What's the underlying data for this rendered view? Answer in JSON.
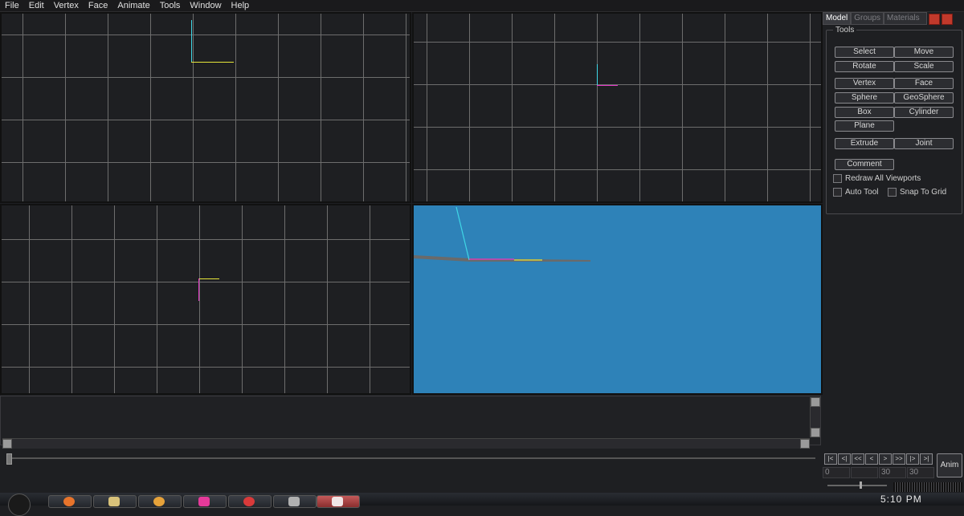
{
  "menubar": {
    "items": [
      "File",
      "Edit",
      "Vertex",
      "Face",
      "Animate",
      "Tools",
      "Window",
      "Help"
    ]
  },
  "right_panel": {
    "tabs": [
      "Model",
      "Groups",
      "Materials"
    ],
    "tools_title": "Tools",
    "buttons": {
      "select": "Select",
      "move": "Move",
      "rotate": "Rotate",
      "scale": "Scale",
      "vertex": "Vertex",
      "face": "Face",
      "sphere": "Sphere",
      "geosphere": "GeoSphere",
      "box": "Box",
      "cylinder": "Cylinder",
      "plane": "Plane",
      "extrude": "Extrude",
      "joint": "Joint",
      "comment": "Comment"
    },
    "checkboxes": {
      "redraw_all": "Redraw All Viewports",
      "auto_tool": "Auto Tool",
      "snap_to_grid": "Snap To Grid"
    }
  },
  "anim_controls": {
    "anim_label": "Anim",
    "frame_start": "0",
    "frame_end": "30",
    "frame_total": "30",
    "nav_buttons": [
      "|<",
      "<|",
      "<<",
      "<",
      ">",
      ">>",
      "|>",
      ">|"
    ]
  },
  "taskbar": {
    "clock": "5:10 PM"
  },
  "colors": {
    "viewport_grey": "#9a9a9a",
    "viewport_blue": "#2e82b8",
    "axis_x": "#e6e63a",
    "axis_y": "#3fd7e6",
    "axis_z": "#e63ac8"
  }
}
